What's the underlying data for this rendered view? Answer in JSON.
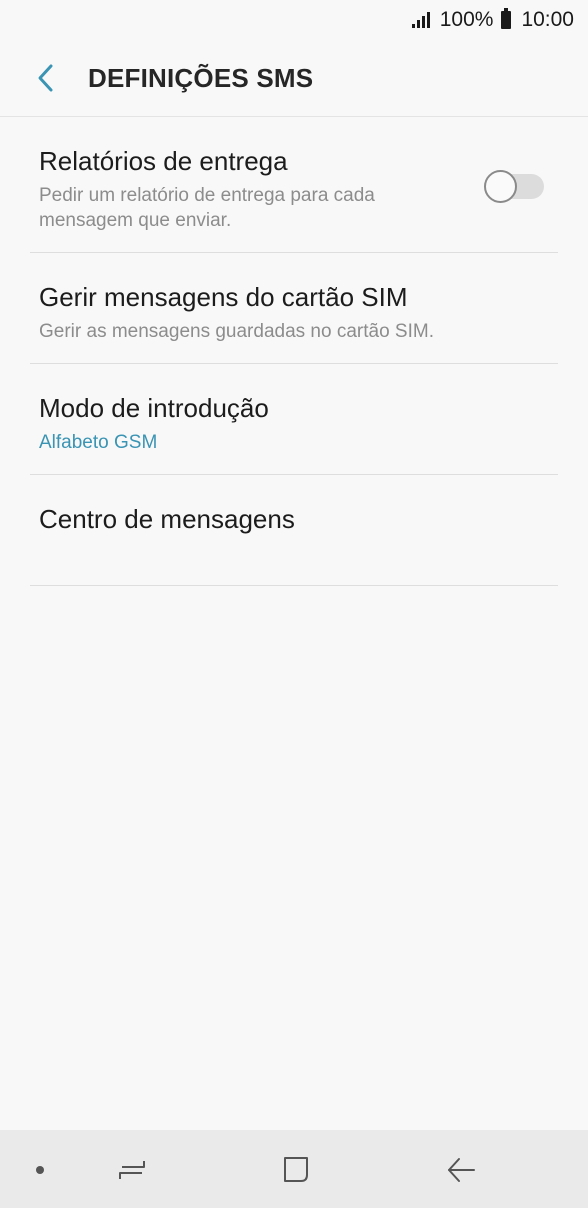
{
  "status_bar": {
    "battery_percent": "100%",
    "time": "10:00"
  },
  "header": {
    "title": "DEFINIÇÕES SMS",
    "back_icon": "chevron-left-icon",
    "accent_color": "#3a94b3"
  },
  "settings": [
    {
      "title": "Relatórios de entrega",
      "summary": "Pedir um relatório de entrega para cada mensagem que enviar.",
      "toggle_on": false
    },
    {
      "title": "Gerir mensagens do cartão SIM",
      "summary": "Gerir as mensagens guardadas no cartão SIM."
    },
    {
      "title": "Modo de introdução",
      "summary": "Alfabeto GSM"
    },
    {
      "title": "Centro de mensagens"
    }
  ],
  "nav_bar": {
    "icons": [
      "dot-icon",
      "recents-icon",
      "home-icon",
      "back-arrow-icon"
    ]
  }
}
